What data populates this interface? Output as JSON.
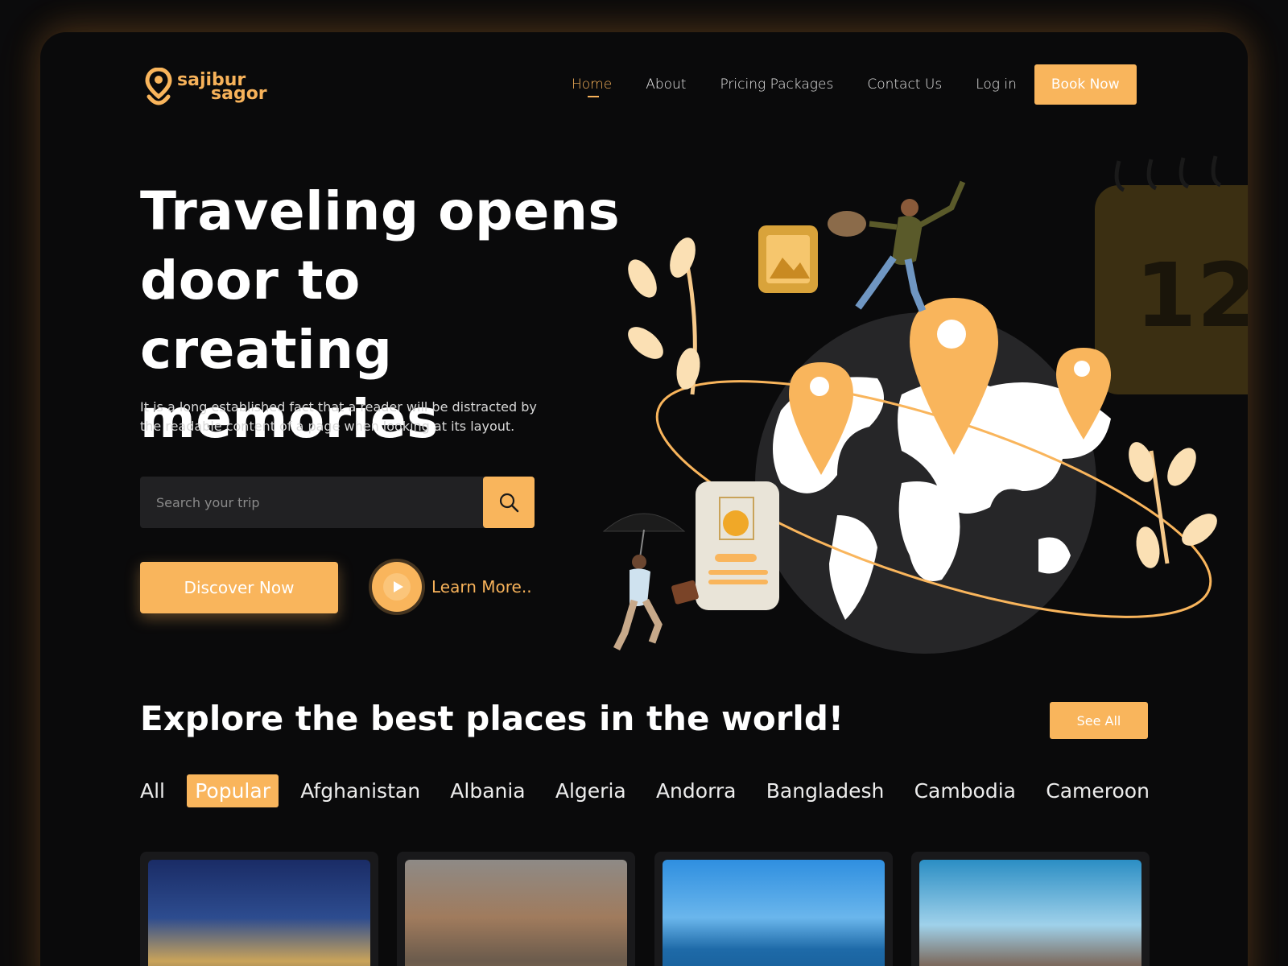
{
  "brand": {
    "line1": "sajibur",
    "line2": "sagor",
    "accent": "#f9b55c"
  },
  "nav": {
    "items": [
      {
        "label": "Home",
        "active": true
      },
      {
        "label": "About",
        "active": false
      },
      {
        "label": "Pricing Packages",
        "active": false
      },
      {
        "label": "Contact Us",
        "active": false
      },
      {
        "label": "Log in",
        "active": false
      }
    ],
    "book_label": "Book Now"
  },
  "hero": {
    "title": "Traveling opens door to creating memories",
    "description": "It is a long established fact that a reader will be distracted by the readable content of a page when looking at its layout.",
    "search_placeholder": "Search your trip",
    "search_icon": "search-icon",
    "discover_label": "Discover Now",
    "learn_label": "Learn More..",
    "play_icon": "play-icon",
    "calendar_number": "12"
  },
  "explore": {
    "title": "Explore the best places in the world!",
    "see_all_label": "See All",
    "filters": [
      "All",
      "Popular",
      "Afghanistan",
      "Albania",
      "Algeria",
      "Andorra",
      "Bangladesh",
      "Cambodia",
      "Cameroon"
    ],
    "active_filter": "Popular",
    "cards": [
      {
        "image": "bridge-night-photo"
      },
      {
        "image": "hillside-town-photo"
      },
      {
        "image": "sea-sky-photo"
      },
      {
        "image": "suspension-bridge-photo"
      }
    ]
  }
}
